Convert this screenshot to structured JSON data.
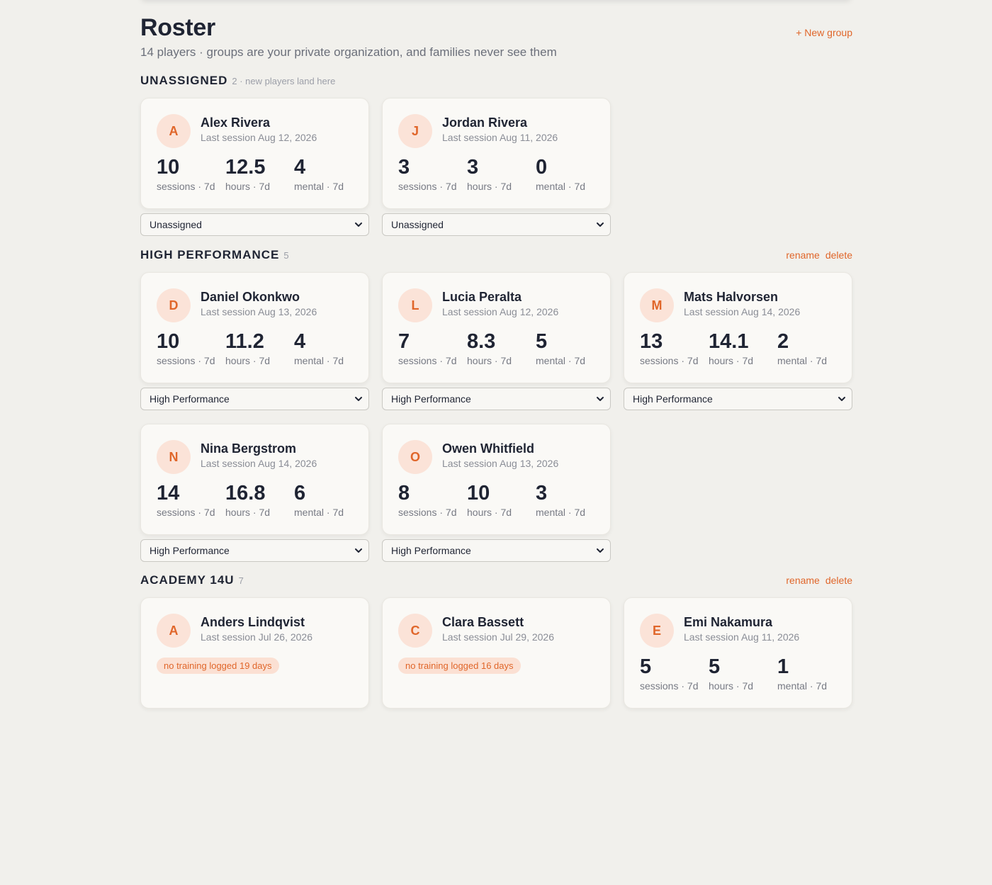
{
  "header": {
    "title": "Roster",
    "subtitle": "14 players · groups are your private organization, and families never see them",
    "new_group_label": "+ New group"
  },
  "groups": [
    {
      "name": "UNASSIGNED",
      "meta": "2 · new players land here",
      "actions": [],
      "players": [
        {
          "initial": "A",
          "name": "Alex Rivera",
          "last_session": "Last session Aug 12, 2026",
          "sessions": "10",
          "hours": "12.5",
          "mental": "4",
          "group_select": "Unassigned"
        },
        {
          "initial": "J",
          "name": "Jordan Rivera",
          "last_session": "Last session Aug 11, 2026",
          "sessions": "3",
          "hours": "3",
          "mental": "0",
          "group_select": "Unassigned"
        }
      ]
    },
    {
      "name": "HIGH PERFORMANCE",
      "meta": "5",
      "actions": [
        "rename",
        "delete"
      ],
      "players": [
        {
          "initial": "D",
          "name": "Daniel Okonkwo",
          "last_session": "Last session Aug 13, 2026",
          "sessions": "10",
          "hours": "11.2",
          "mental": "4",
          "group_select": "High Performance"
        },
        {
          "initial": "L",
          "name": "Lucia Peralta",
          "last_session": "Last session Aug 12, 2026",
          "sessions": "7",
          "hours": "8.3",
          "mental": "5",
          "group_select": "High Performance"
        },
        {
          "initial": "M",
          "name": "Mats Halvorsen",
          "last_session": "Last session Aug 14, 2026",
          "sessions": "13",
          "hours": "14.1",
          "mental": "2",
          "group_select": "High Performance"
        },
        {
          "initial": "N",
          "name": "Nina Bergstrom",
          "last_session": "Last session Aug 14, 2026",
          "sessions": "14",
          "hours": "16.8",
          "mental": "6",
          "group_select": "High Performance"
        },
        {
          "initial": "O",
          "name": "Owen Whitfield",
          "last_session": "Last session Aug 13, 2026",
          "sessions": "8",
          "hours": "10",
          "mental": "3",
          "group_select": "High Performance"
        }
      ]
    },
    {
      "name": "ACADEMY 14U",
      "meta": "7",
      "actions": [
        "rename",
        "delete"
      ],
      "players": [
        {
          "initial": "A",
          "name": "Anders Lindqvist",
          "last_session": "Last session Jul 26, 2026",
          "badge": "no training logged 19 days"
        },
        {
          "initial": "C",
          "name": "Clara Bassett",
          "last_session": "Last session Jul 29, 2026",
          "badge": "no training logged 16 days"
        },
        {
          "initial": "E",
          "name": "Emi Nakamura",
          "last_session": "Last session Aug 11, 2026",
          "sessions": "5",
          "hours": "5",
          "mental": "1"
        }
      ]
    }
  ],
  "stat_labels": {
    "sessions": "sessions · 7d",
    "hours": "hours · 7d",
    "mental": "mental · 7d"
  },
  "colors": {
    "accent": "#e0662a",
    "avatar_bg": "#fbe3d8",
    "page_bg": "#f1f0ec",
    "card_bg": "#faf9f6"
  }
}
